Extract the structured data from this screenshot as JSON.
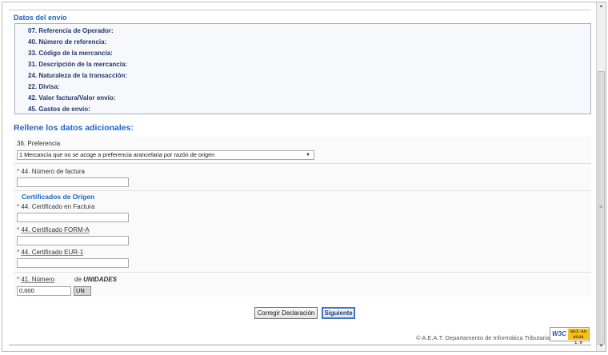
{
  "datos": {
    "title": "Datos del envío",
    "rows": [
      "07. Referencia de Operador:",
      "40. Número de referencia:",
      "33. Código de la mercancía:",
      "31. Descripción de la mercancía:",
      "24. Naturaleza de la transacción:",
      "22. Divisa:",
      "42. Valor factura/Valor envío:",
      "45. Gastos de envío:"
    ]
  },
  "form": {
    "title": "Rellene los datos adicionales:",
    "preferencia_label": "36. Preferencia",
    "preferencia_value": "1 Mercancía que no se acoge a preferencia arancelaria por razón de origen",
    "req_mark": "*",
    "factura_label": "44. Número de factura",
    "factura_value": "",
    "certificados_title": "Certificados de Origen",
    "cert_factura_label": "44. Certificado en Factura",
    "cert_factura_value": "",
    "form_a_label": "44. Certificado FORM-A",
    "form_a_value": "",
    "eur1_label": "44. Certificado EUR-1",
    "eur1_value": "",
    "numero_label": "41. Número",
    "de_label": "de",
    "unidades_label": "UNIDADES",
    "numero_value": "0,000",
    "unidad_value": "UN"
  },
  "buttons": {
    "corregir": "Corregir Declaración",
    "siguiente": "Siguiente"
  },
  "footer": {
    "text": "© A.E.A.T. Departamento de Informática Tributaria",
    "badge_left": "W3C",
    "badge_right_1": "WAI-AA",
    "badge_right_2": "WCAG 1.0"
  },
  "icons": {
    "dropdown": "chevron-down-icon",
    "scroll_grip": "grip-icon",
    "scroll_up": "arrow-up-icon",
    "scroll_down": "arrow-down-icon"
  },
  "colors": {
    "heading_blue": "#1e66c2",
    "required_red": "#d11b1b",
    "badge_yellow": "#f3c31a"
  }
}
